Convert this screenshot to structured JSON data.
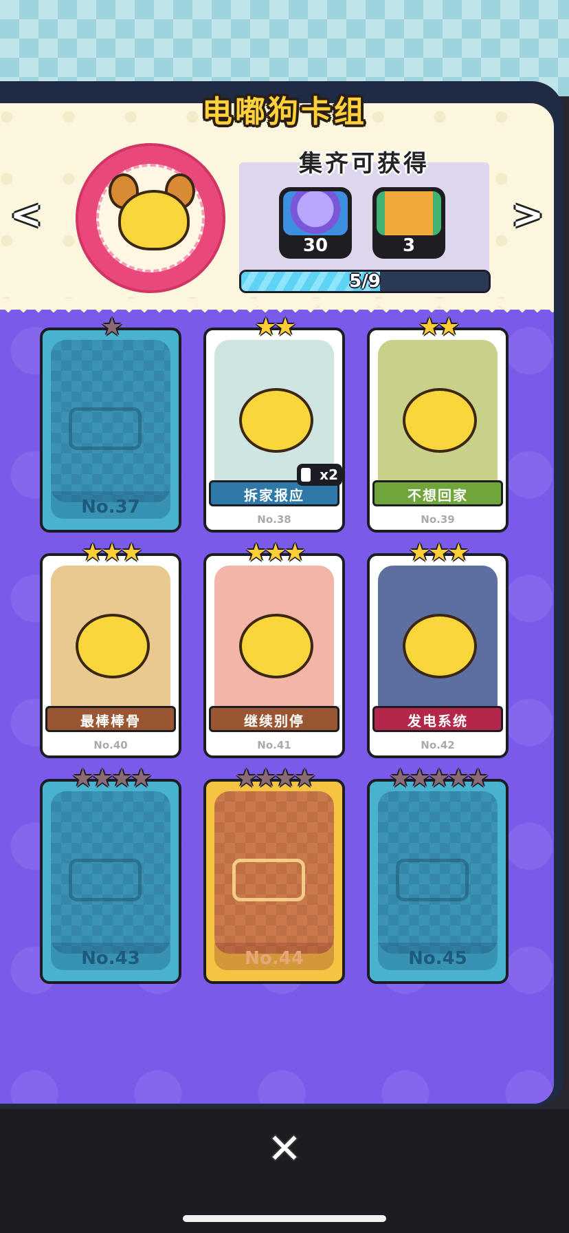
{
  "title": "电嘟狗卡组",
  "nav": {
    "prev_icon": "chevron-left-icon",
    "next_icon": "chevron-right-icon"
  },
  "reward": {
    "title": "集齐可获得",
    "items": [
      {
        "icon": "capsule-icon",
        "count": "30"
      },
      {
        "icon": "phone-card-icon",
        "count": "3"
      }
    ]
  },
  "progress": {
    "text": "5/9",
    "fraction": 0.56
  },
  "cards": [
    {
      "no": "No.37",
      "stars": 1,
      "locked": true,
      "style": "blue"
    },
    {
      "no": "No.38",
      "name": "拆家报应",
      "stars": 2,
      "locked": false,
      "ribbon": "#2f79a8",
      "scene": "#cfe5e2",
      "dup": "x2"
    },
    {
      "no": "No.39",
      "name": "不想回家",
      "stars": 2,
      "locked": false,
      "ribbon": "#6fa53a",
      "scene": "#c9d089"
    },
    {
      "no": "No.40",
      "name": "最棒棒骨",
      "stars": 3,
      "locked": false,
      "ribbon": "#9a5632",
      "scene": "#e9c98f"
    },
    {
      "no": "No.41",
      "name": "继续别停",
      "stars": 3,
      "locked": false,
      "ribbon": "#9a5632",
      "scene": "#f2b5a8"
    },
    {
      "no": "No.42",
      "name": "发电系统",
      "stars": 3,
      "locked": false,
      "ribbon": "#b3284a",
      "scene": "#5c6fa0"
    },
    {
      "no": "No.43",
      "stars": 4,
      "locked": true,
      "style": "blue"
    },
    {
      "no": "No.44",
      "stars": 4,
      "locked": true,
      "style": "gold"
    },
    {
      "no": "No.45",
      "stars": 5,
      "locked": true,
      "style": "blue"
    }
  ],
  "close_icon": "close-icon"
}
